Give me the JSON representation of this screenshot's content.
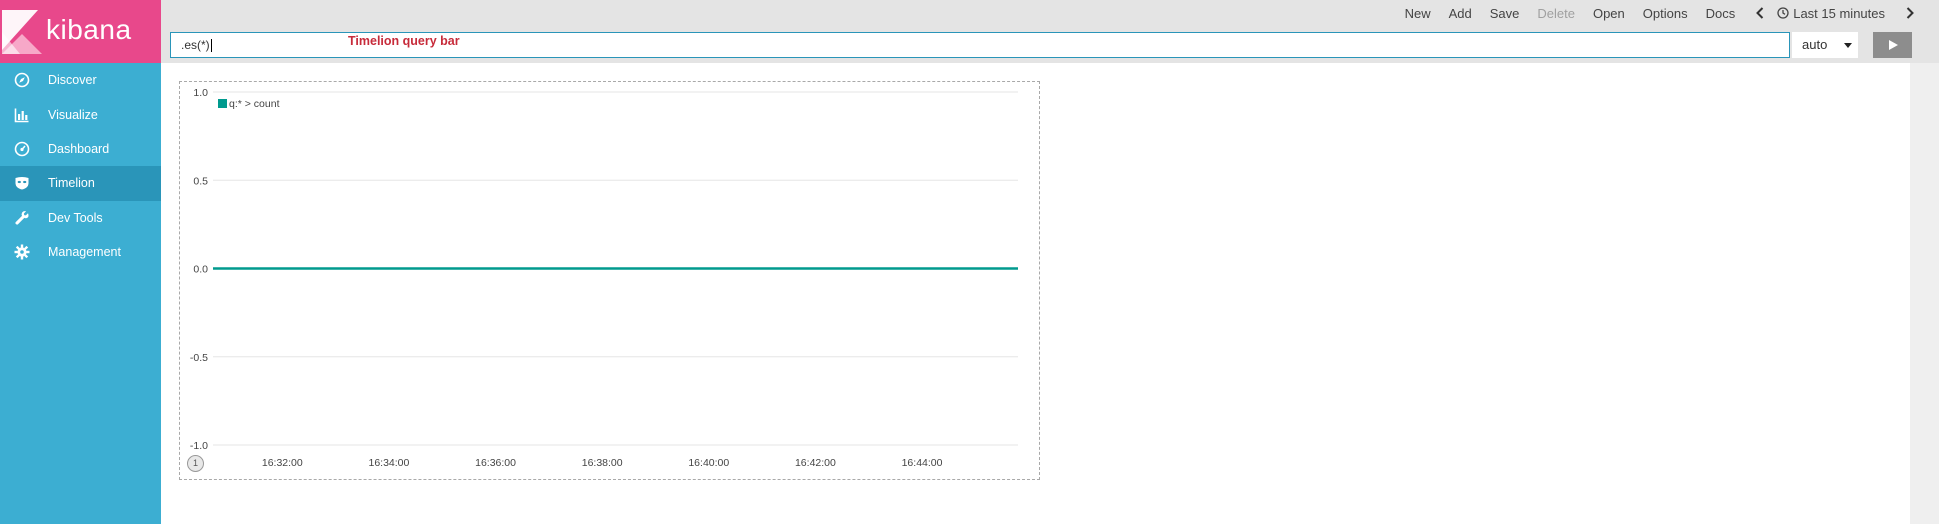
{
  "brand": {
    "name": "kibana",
    "logo_color": "#e8488b",
    "sidebar_color": "#3caed2",
    "active_color": "#2a95b9"
  },
  "sidebar": {
    "items": [
      {
        "label": "Discover",
        "icon": "compass-icon",
        "active": false
      },
      {
        "label": "Visualize",
        "icon": "bar-chart-icon",
        "active": false
      },
      {
        "label": "Dashboard",
        "icon": "dashboard-gauge-icon",
        "active": false
      },
      {
        "label": "Timelion",
        "icon": "timelion-mask-icon",
        "active": true
      },
      {
        "label": "Dev Tools",
        "icon": "wrench-icon",
        "active": false
      },
      {
        "label": "Management",
        "icon": "gear-icon",
        "active": false
      }
    ]
  },
  "toolbar": {
    "new": "New",
    "add": "Add",
    "save": "Save",
    "delete": "Delete",
    "open": "Open",
    "options": "Options",
    "docs": "Docs",
    "time_range": "Last 15 minutes"
  },
  "query": {
    "value": ".es(*)",
    "annotation": "Timelion query bar",
    "interval": "auto"
  },
  "panel": {
    "badge": "1"
  },
  "chart_data": {
    "type": "line",
    "title": "",
    "xlabel": "",
    "ylabel": "",
    "ylim": [
      -1.0,
      1.0
    ],
    "y_ticks": [
      "1.0",
      "0.5",
      "0.0",
      "-0.5",
      "-1.0"
    ],
    "x_ticks": [
      "16:32:00",
      "16:34:00",
      "16:36:00",
      "16:38:00",
      "16:40:00",
      "16:42:00",
      "16:44:00"
    ],
    "x_range": [
      "16:30:42",
      "16:45:48"
    ],
    "grid": true,
    "legend_position": "top-left",
    "series": [
      {
        "name": "q:* > count",
        "color": "#009a8e",
        "x": [
          "16:30:42",
          "16:45:48"
        ],
        "values": [
          0,
          0
        ]
      }
    ]
  }
}
